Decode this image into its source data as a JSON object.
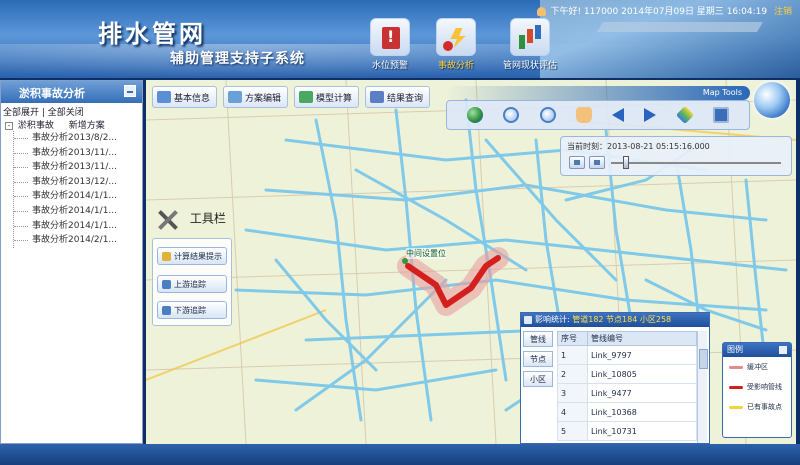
{
  "header": {
    "title": "排水管网",
    "subtitle": "辅助管理支持子系统",
    "greeting": "下午好! 117000",
    "date": "2014年07月09日 星期三",
    "time": "16:04:19",
    "logout": "注销"
  },
  "nav": [
    {
      "label": "水位预警",
      "icon": "warning-book-icon",
      "active": false
    },
    {
      "label": "事故分析",
      "icon": "lightning-icon",
      "active": true
    },
    {
      "label": "管网现状评估",
      "icon": "bar-chart-icon",
      "active": false
    }
  ],
  "left_panel": {
    "title": "淤积事故分析",
    "expand_all": "全部展开",
    "collapse_all": "全部关闭",
    "root": "淤积事故",
    "new_scheme": "新增方案",
    "items": [
      "事故分析2013/8/2...",
      "事故分析2013/11/...",
      "事故分析2013/11/...",
      "事故分析2013/12/...",
      "事故分析2014/1/1...",
      "事故分析2014/1/1...",
      "事故分析2014/1/1...",
      "事故分析2014/2/1..."
    ]
  },
  "map_tabs": [
    {
      "label": "基本信息",
      "color": "#5a8fd6"
    },
    {
      "label": "方案编辑",
      "color": "#6aa0d8"
    },
    {
      "label": "模型计算",
      "color": "#4aa860"
    },
    {
      "label": "结果查询",
      "color": "#5a7fc4"
    }
  ],
  "map_tools": {
    "title": "Map Tools",
    "tools": [
      "globe-icon",
      "zoom-in-icon",
      "zoom-out-icon",
      "pan-hand-icon",
      "back-arrow-icon",
      "forward-arrow-icon",
      "layers-icon",
      "full-screen-icon"
    ]
  },
  "time_panel": {
    "label": "当前时刻：2013-08-21 05:15:16.000"
  },
  "tools_panel": {
    "title": "工具栏",
    "buttons": [
      "计算结果提示",
      "上游追踪",
      "下游追踪"
    ]
  },
  "map_labels": {
    "location": "中间设置位"
  },
  "stats": {
    "title_prefix": "影响统计: ",
    "summary": "管道182 节点184 小区258",
    "tabs": [
      "管线",
      "节点",
      "小区"
    ],
    "columns": [
      "序号",
      "管线编号"
    ],
    "rows": [
      [
        "1",
        "Link_9797"
      ],
      [
        "2",
        "Link_10805"
      ],
      [
        "3",
        "Link_9477"
      ],
      [
        "4",
        "Link_10368"
      ],
      [
        "5",
        "Link_10731"
      ]
    ]
  },
  "legend": {
    "title": "图例",
    "items": [
      {
        "label": "缓冲区",
        "color": "#e58a8a"
      },
      {
        "label": "受影响管线",
        "color": "#d41f1f"
      },
      {
        "label": "已有事故点",
        "color": "#f2d33a"
      }
    ]
  }
}
